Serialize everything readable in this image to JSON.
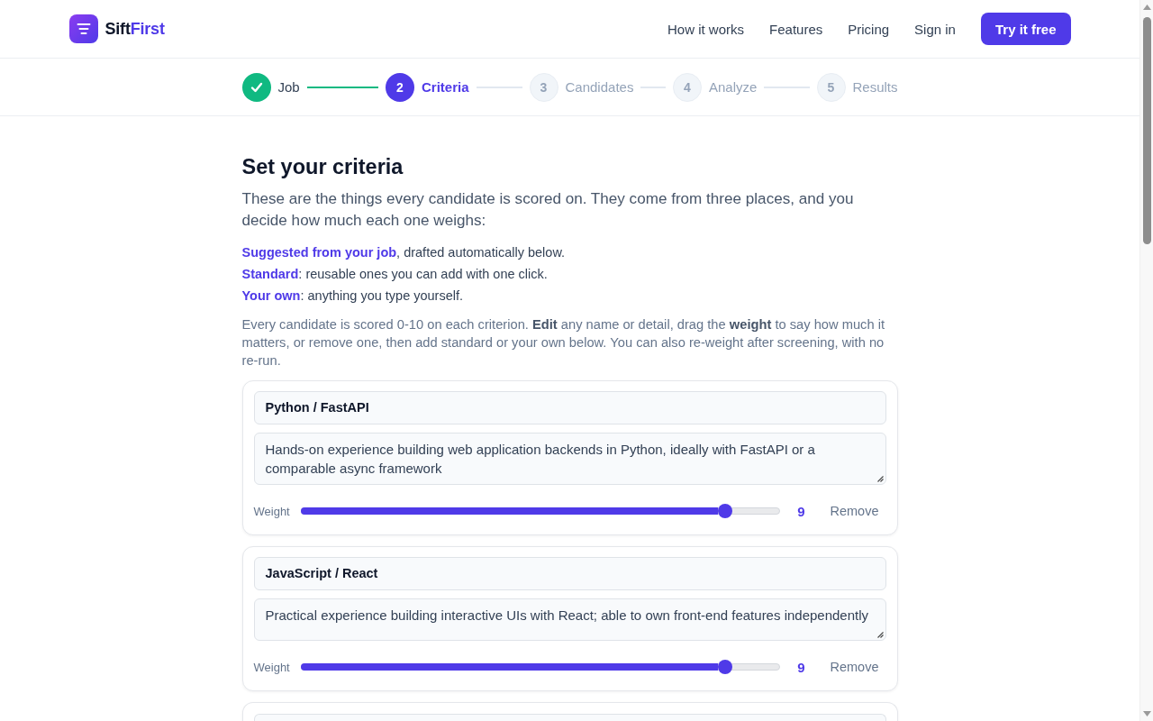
{
  "header": {
    "brand": {
      "text": "Sift",
      "accent": "First"
    },
    "nav": [
      "How it works",
      "Features",
      "Pricing",
      "Sign in"
    ],
    "cta": "Try it free"
  },
  "steps": [
    {
      "label": "Job",
      "done": true,
      "selected": false
    },
    {
      "number": "2",
      "label": "Criteria",
      "done": false,
      "selected": true
    },
    {
      "number": "3",
      "label": "Candidates",
      "done": false,
      "selected": false
    },
    {
      "number": "4",
      "label": "Analyze",
      "done": false,
      "selected": false
    },
    {
      "number": "5",
      "label": "Results",
      "done": false,
      "selected": false
    }
  ],
  "intro": {
    "title": "Set your criteria",
    "lead": "These are the things every candidate is scored on. They come from three places, and you decide how much each one weighs:",
    "sources": [
      "**Suggested from your job**, drafted automatically below.",
      "**Standard**: reusable ones you can add with one click.",
      "**Your own**: anything you type yourself."
    ],
    "note": "Every candidate is scored 0-10 on each criterion. **Edit** any name or detail, drag the **weight** to say how much it matters, or remove one, then add standard or your own below. You can also re-weight after screening, with no re-run."
  },
  "criteria": [
    {
      "name": "Python / FastAPI",
      "detail": "Hands-on experience building web application backends in Python, ideally with FastAPI or a comparable async framework",
      "weight_label": "Weight",
      "level": 0.9,
      "weight": "9",
      "remove": "Remove"
    },
    {
      "name": "JavaScript / React",
      "detail": "Practical experience building interactive UIs with React; able to own front-end features independently",
      "weight_label": "Weight",
      "level": 0.9,
      "weight": "9",
      "remove": "Remove"
    }
  ]
}
